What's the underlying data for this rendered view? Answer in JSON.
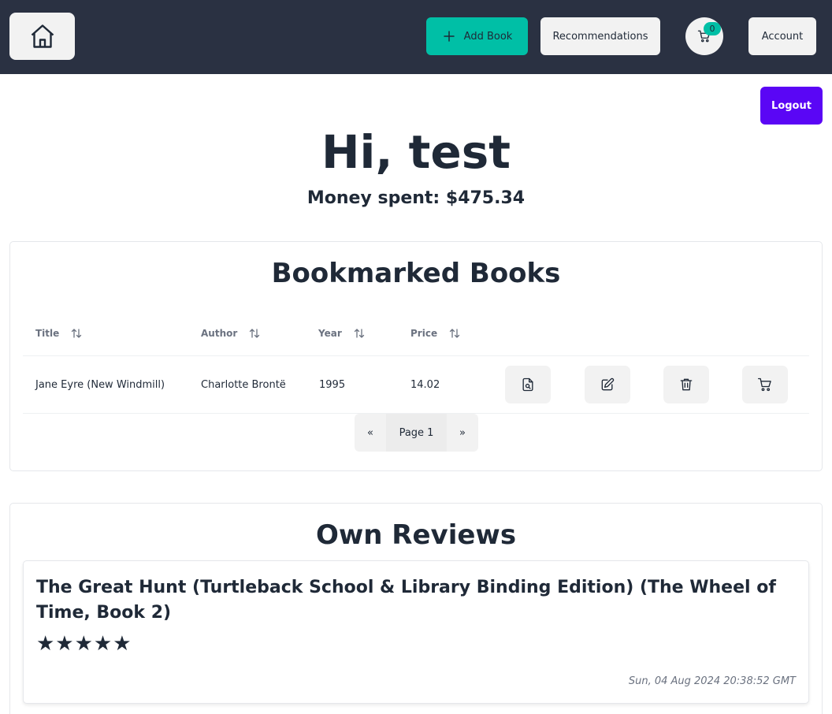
{
  "navbar": {
    "home_icon": "home-icon",
    "add_book_label": "Add Book",
    "recommendations_label": "Recommendations",
    "cart_count": "0",
    "account_label": "Account"
  },
  "logout_label": "Logout",
  "greeting": "Hi, test",
  "money_spent": "Money spent: $475.34",
  "bookmarks": {
    "title": "Bookmarked Books",
    "columns": [
      "Title",
      "Author",
      "Year",
      "Price"
    ],
    "rows": [
      {
        "title": "Jane Eyre (New Windmill)",
        "author": "Charlotte Brontë",
        "year": "1995",
        "price": "14.02"
      }
    ],
    "actions": [
      "view-icon",
      "edit-icon",
      "trash-icon",
      "cart-icon"
    ],
    "pagination": {
      "prev": "«",
      "current": "Page 1",
      "next": "»"
    }
  },
  "reviews": {
    "title": "Own Reviews",
    "items": [
      {
        "book_title": "The Great Hunt (Turtleback School & Library Binding Edition) (The Wheel of Time, Book 2)",
        "stars": "★★★★★",
        "rating": 5,
        "date": "Sun, 04 Aug 2024 20:38:52 GMT"
      }
    ]
  },
  "colors": {
    "navbar": "#2a3142",
    "accent": "#00bfa6",
    "logout": "#5a06f5",
    "button": "#f2f2f2"
  }
}
